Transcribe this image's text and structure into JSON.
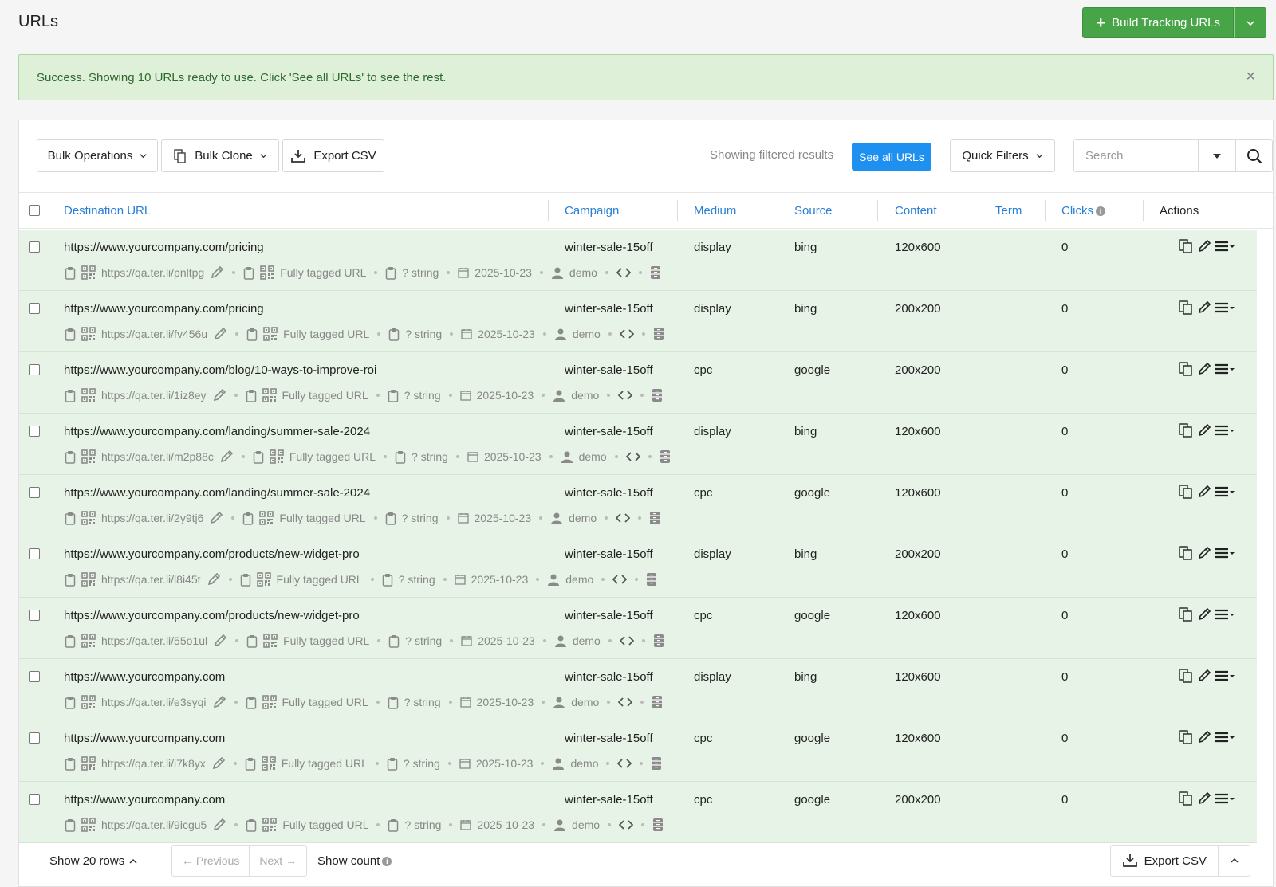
{
  "header": {
    "title": "URLs",
    "build_label": "Build Tracking URLs"
  },
  "alert": {
    "message": "Success. Showing 10 URLs ready to use. Click 'See all URLs' to see the rest.",
    "close": "×"
  },
  "toolbar": {
    "bulk_operations": "Bulk Operations",
    "bulk_clone": "Bulk Clone",
    "export_csv": "Export CSV",
    "showing_text": "Showing filtered results",
    "see_all": "See all URLs",
    "quick_filters": "Quick Filters",
    "search_placeholder": "Search"
  },
  "columns": {
    "destination": "Destination URL",
    "campaign": "Campaign",
    "medium": "Medium",
    "source": "Source",
    "content": "Content",
    "term": "Term",
    "clicks": "Clicks",
    "actions": "Actions"
  },
  "rows": [
    {
      "url": "https://www.yourcompany.com/pricing",
      "campaign": "winter-sale-15off",
      "medium": "display",
      "source": "bing",
      "content": "120x600",
      "term": "",
      "clicks": "0",
      "short": "https://qa.ter.li/pnltpg",
      "tagged": "Fully tagged URL",
      "type": "? string",
      "date": "2025-10-23",
      "user": "demo"
    },
    {
      "url": "https://www.yourcompany.com/pricing",
      "campaign": "winter-sale-15off",
      "medium": "display",
      "source": "bing",
      "content": "200x200",
      "term": "",
      "clicks": "0",
      "short": "https://qa.ter.li/fv456u",
      "tagged": "Fully tagged URL",
      "type": "? string",
      "date": "2025-10-23",
      "user": "demo"
    },
    {
      "url": "https://www.yourcompany.com/blog/10-ways-to-improve-roi",
      "campaign": "winter-sale-15off",
      "medium": "cpc",
      "source": "google",
      "content": "200x200",
      "term": "",
      "clicks": "0",
      "short": "https://qa.ter.li/1iz8ey",
      "tagged": "Fully tagged URL",
      "type": "? string",
      "date": "2025-10-23",
      "user": "demo"
    },
    {
      "url": "https://www.yourcompany.com/landing/summer-sale-2024",
      "campaign": "winter-sale-15off",
      "medium": "display",
      "source": "bing",
      "content": "120x600",
      "term": "",
      "clicks": "0",
      "short": "https://qa.ter.li/m2p88c",
      "tagged": "Fully tagged URL",
      "type": "? string",
      "date": "2025-10-23",
      "user": "demo"
    },
    {
      "url": "https://www.yourcompany.com/landing/summer-sale-2024",
      "campaign": "winter-sale-15off",
      "medium": "cpc",
      "source": "google",
      "content": "120x600",
      "term": "",
      "clicks": "0",
      "short": "https://qa.ter.li/2y9tj6",
      "tagged": "Fully tagged URL",
      "type": "? string",
      "date": "2025-10-23",
      "user": "demo"
    },
    {
      "url": "https://www.yourcompany.com/products/new-widget-pro",
      "campaign": "winter-sale-15off",
      "medium": "display",
      "source": "bing",
      "content": "200x200",
      "term": "",
      "clicks": "0",
      "short": "https://qa.ter.li/l8i45t",
      "tagged": "Fully tagged URL",
      "type": "? string",
      "date": "2025-10-23",
      "user": "demo"
    },
    {
      "url": "https://www.yourcompany.com/products/new-widget-pro",
      "campaign": "winter-sale-15off",
      "medium": "cpc",
      "source": "google",
      "content": "120x600",
      "term": "",
      "clicks": "0",
      "short": "https://qa.ter.li/55o1ul",
      "tagged": "Fully tagged URL",
      "type": "? string",
      "date": "2025-10-23",
      "user": "demo"
    },
    {
      "url": "https://www.yourcompany.com",
      "campaign": "winter-sale-15off",
      "medium": "display",
      "source": "bing",
      "content": "120x600",
      "term": "",
      "clicks": "0",
      "short": "https://qa.ter.li/e3syqi",
      "tagged": "Fully tagged URL",
      "type": "? string",
      "date": "2025-10-23",
      "user": "demo"
    },
    {
      "url": "https://www.yourcompany.com",
      "campaign": "winter-sale-15off",
      "medium": "cpc",
      "source": "google",
      "content": "120x600",
      "term": "",
      "clicks": "0",
      "short": "https://qa.ter.li/i7k8yx",
      "tagged": "Fully tagged URL",
      "type": "? string",
      "date": "2025-10-23",
      "user": "demo"
    },
    {
      "url": "https://www.yourcompany.com",
      "campaign": "winter-sale-15off",
      "medium": "cpc",
      "source": "google",
      "content": "200x200",
      "term": "",
      "clicks": "0",
      "short": "https://qa.ter.li/9icgu5",
      "tagged": "Fully tagged URL",
      "type": "? string",
      "date": "2025-10-23",
      "user": "demo"
    }
  ],
  "footer": {
    "show_rows": "Show 20 rows",
    "previous": "← Previous",
    "next": "Next →",
    "show_count": "Show count",
    "export_csv": "Export CSV"
  },
  "colors": {
    "primary_green": "#47a447",
    "link_blue": "#2a7fd4",
    "button_blue": "#1e90f0",
    "row_bg": "#e6f3e6"
  }
}
